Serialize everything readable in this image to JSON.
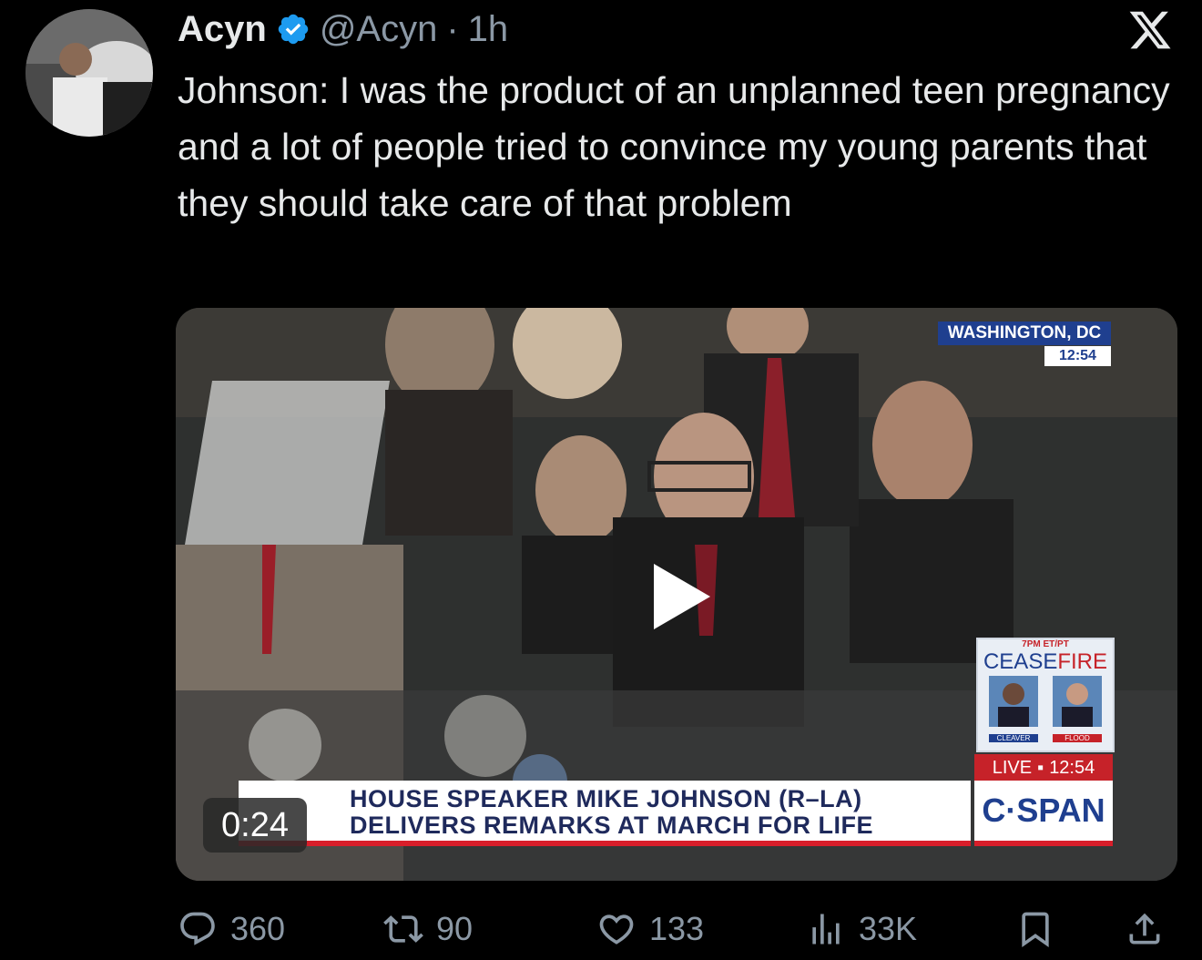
{
  "tweet": {
    "display_name": "Acyn",
    "handle": "@Acyn",
    "separator": "·",
    "time": "1h",
    "text": "Johnson: I was the product of an unplanned teen pregnancy and a lot of people tried to convince my young parents that they should take care of that problem"
  },
  "video": {
    "duration": "0:24",
    "chyron_line1": "HOUSE SPEAKER MIKE JOHNSON (R–LA)",
    "chyron_line2": "DELIVERS REMARKS AT MARCH FOR LIFE",
    "network": "C·SPAN",
    "live_label": "LIVE",
    "live_time": "12:54",
    "location": "WASHINGTON, DC",
    "location_time": "12:54",
    "promo_top": "7PM ET/PT",
    "promo_title_a": "CEASE",
    "promo_title_b": "FIRE",
    "promo_name_left": "CLEAVER",
    "promo_name_right": "FLOOD"
  },
  "actions": {
    "replies": "360",
    "reposts": "90",
    "likes": "133",
    "views": "33K"
  },
  "colors": {
    "background": "#000000",
    "text_primary": "#e7e9ea",
    "text_secondary": "#8b98a5",
    "verified": "#1d9bf0"
  }
}
